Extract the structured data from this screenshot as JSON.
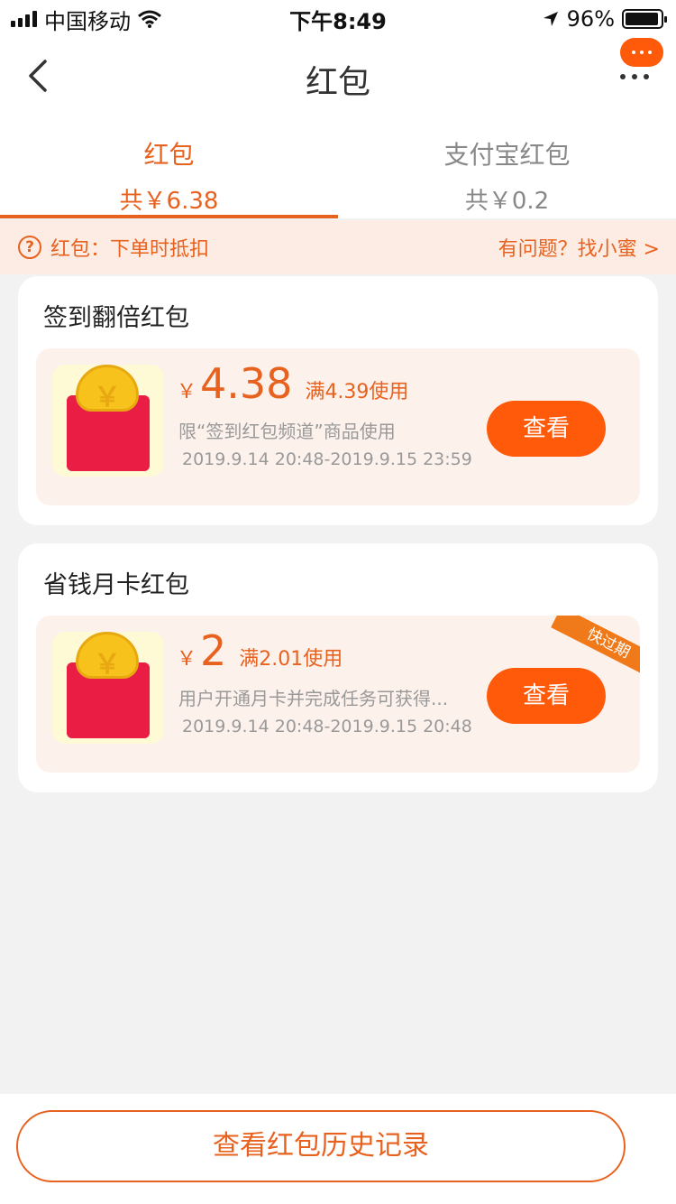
{
  "status_bar": {
    "carrier": "中国移动",
    "time": "下午8:49",
    "battery": "96%",
    "battery_level": 0.96
  },
  "nav": {
    "title": "红包",
    "back_icon": "chevron-left-icon",
    "more_icon": "more-icon"
  },
  "tabs": [
    {
      "label": "红包",
      "total": "共￥6.38",
      "active": true
    },
    {
      "label": "支付宝红包",
      "total": "共￥0.2",
      "active": false
    }
  ],
  "notice": {
    "left": "红包：下单时抵扣",
    "right": "有问题？找小蜜 >"
  },
  "sections": [
    {
      "title": "签到翻倍红包",
      "coupon": {
        "currency": "￥",
        "amount": "4.38",
        "condition": "满4.39使用",
        "limit": "限“签到红包频道”商品使用",
        "period": "2019.9.14 20:48-2019.9.15 23:59",
        "button": "查看"
      }
    },
    {
      "title": "省钱月卡红包",
      "coupon": {
        "currency": "￥",
        "amount": "2",
        "condition": "满2.01使用",
        "limit": "用户开通月卡并完成任务可获得...",
        "period": "2019.9.14 20:48-2019.9.15 20:48",
        "button": "查看",
        "badge": "快过期"
      }
    }
  ],
  "icons": {
    "coin_symbol": "￥",
    "help": "?"
  },
  "footer": {
    "button": "查看红包历史记录"
  },
  "colors": {
    "accent": "#e8621f",
    "button": "#ff5a0a",
    "envelope": "#ea1d44",
    "coin": "#f6c21b"
  }
}
